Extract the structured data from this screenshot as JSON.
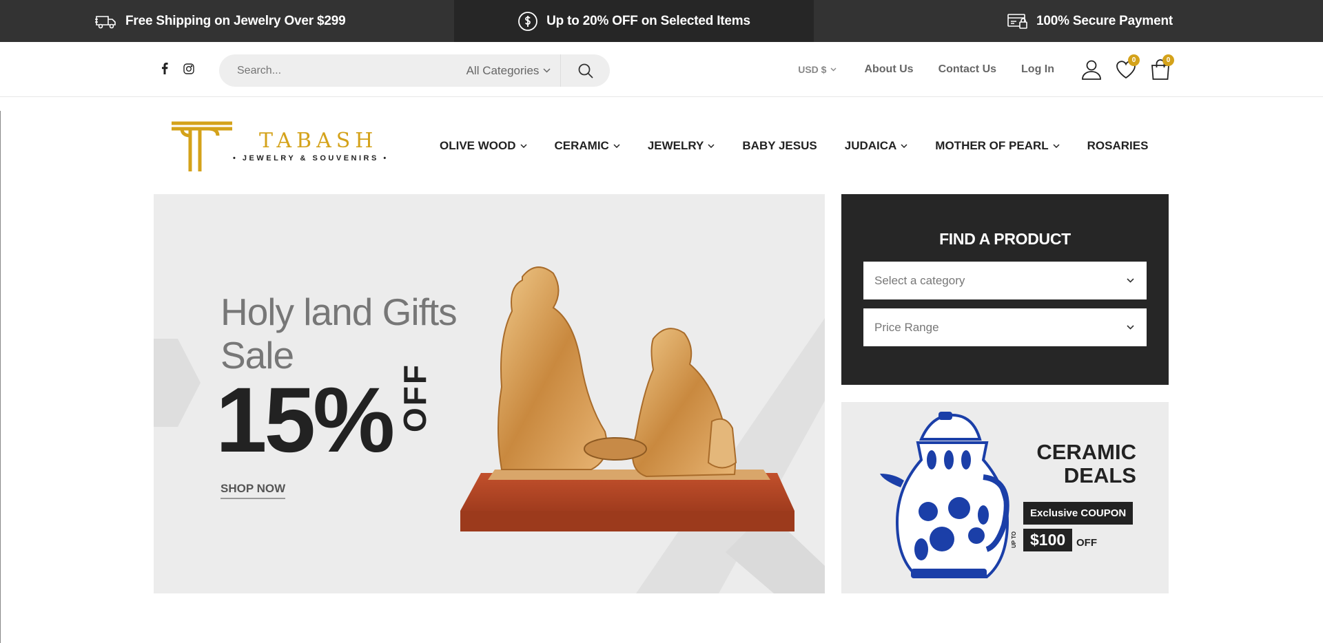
{
  "topbar": {
    "shipping": "Free Shipping on Jewelry Over $299",
    "discount": "Up to 20% OFF on Selected Items",
    "payment": "100% Secure Payment"
  },
  "header": {
    "search_placeholder": "Search...",
    "category_select": "All Categories",
    "currency": "USD $",
    "links": [
      "About Us",
      "Contact Us",
      "Log In"
    ],
    "wishlist_count": "0",
    "cart_count": "0"
  },
  "logo": {
    "brand": "TABASH",
    "tagline": "• JEWELRY & SOUVENIRS •"
  },
  "nav": {
    "items": [
      "OLIVE WOOD",
      "CERAMIC",
      "JEWELRY",
      "BABY JESUS",
      "JUDAICA",
      "MOTHER OF PEARL",
      "ROSARIES"
    ]
  },
  "hero": {
    "title_line1": "Holy land Gifts",
    "title_line2": "Sale",
    "percent": "15%",
    "off": "OFF",
    "cta": "SHOP NOW"
  },
  "finder": {
    "title": "FIND A PRODUCT",
    "category_placeholder": "Select a category",
    "price_placeholder": "Price Range"
  },
  "deals": {
    "title_line1": "CERAMIC",
    "title_line2": "DEALS",
    "coupon": "Exclusive COUPON",
    "up_to": "UP TO",
    "amount": "$100",
    "off": "OFF"
  },
  "colors": {
    "accent_gold": "#d4a21a",
    "dark": "#262626",
    "hero_bg": "#ececec"
  }
}
